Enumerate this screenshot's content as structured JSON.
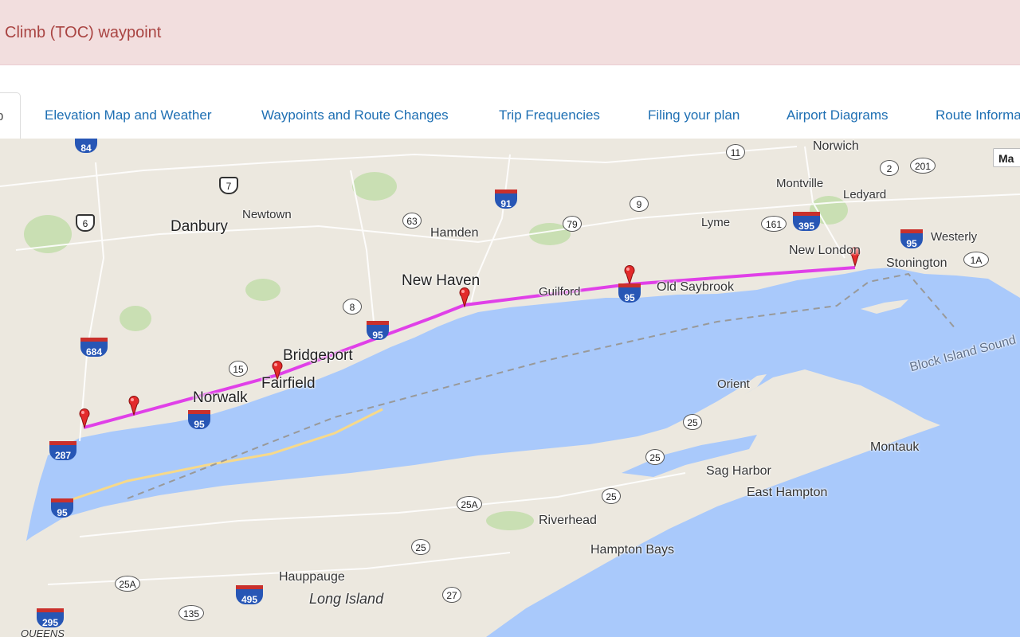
{
  "alert": {
    "text": "Climb (TOC) waypoint"
  },
  "tabs": {
    "active_label": "b",
    "items": [
      "Elevation Map and Weather",
      "Waypoints and Route Changes",
      "Trip Frequencies",
      "Filing your plan",
      "Airport Diagrams",
      "Route Informa"
    ]
  },
  "map": {
    "map_type_label": "Ma",
    "route_color": "#e040e8",
    "water_color": "#a9c9fb",
    "land_color": "#ece8df",
    "places": {
      "norwich": "Norwich",
      "montville": "Montville",
      "ledyard": "Ledyard",
      "danbury": "Danbury",
      "newtown": "Newtown",
      "hamden": "Hamden",
      "lyme": "Lyme",
      "new_london": "New London",
      "westerly": "Westerly",
      "stonington": "Stonington",
      "new_haven": "New Haven",
      "guilford": "Guilford",
      "old_saybrook": "Old Saybrook",
      "bridgeport": "Bridgeport",
      "fairfield": "Fairfield",
      "norwalk": "Norwalk",
      "block_island_sound": "Block Island Sound",
      "orient": "Orient",
      "montauk": "Montauk",
      "sag_harbor": "Sag Harbor",
      "east_hampton": "East Hampton",
      "riverhead": "Riverhead",
      "hampton_bays": "Hampton Bays",
      "hauppauge": "Hauppauge",
      "long_island": "Long Island",
      "queens": "QUEENS"
    },
    "shields": {
      "i84": "84",
      "us7": "7",
      "us6": "6",
      "r11": "11",
      "r2": "2",
      "r201": "201",
      "i91": "91",
      "r63": "63",
      "r79": "79",
      "r9": "9",
      "r161": "161",
      "i395": "395",
      "i95_ne": "95",
      "r1a": "1A",
      "r8": "8",
      "i95_c": "95",
      "i95_g": "95",
      "i684": "684",
      "r15": "15",
      "i95_w": "95",
      "i287": "287",
      "i95_sw": "95",
      "r25_a": "25",
      "r25_b": "25",
      "r25_c": "25",
      "r25a_e": "25A",
      "r25_d": "25",
      "r25a_w": "25A",
      "i495": "495",
      "r27": "27",
      "r135": "135",
      "i295": "295"
    }
  }
}
